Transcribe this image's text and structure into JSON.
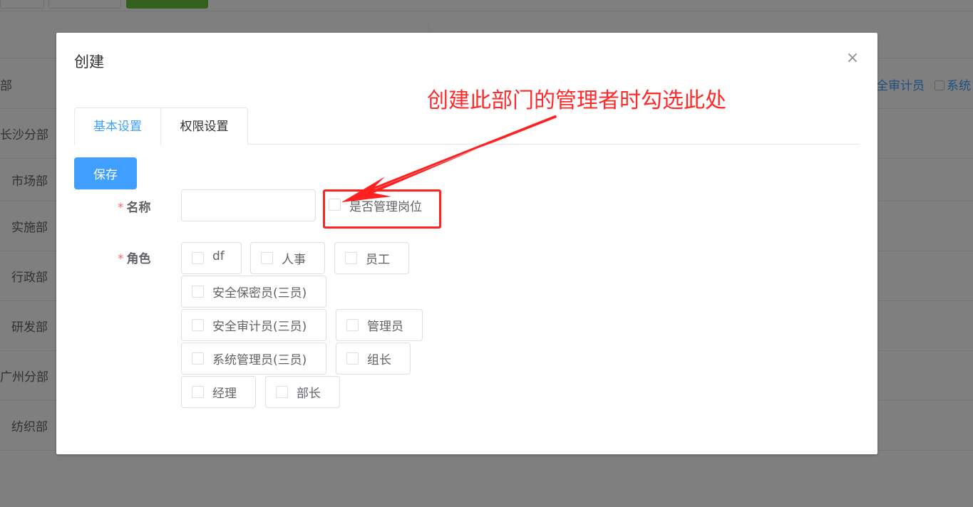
{
  "background": {
    "toolbar_buttons": [
      "",
      "",
      ""
    ],
    "right_labels": [
      "全审计员",
      "系统"
    ],
    "departments": [
      "部",
      "长沙分部",
      "市场部",
      "实施部",
      "行政部",
      "研发部",
      "广州分部",
      "纺织部"
    ]
  },
  "dialog": {
    "title": "创建",
    "close_icon": "×",
    "tabs": [
      {
        "label": "基本设置",
        "active": true
      },
      {
        "label": "权限设置",
        "active": false
      }
    ],
    "save_label": "保存",
    "name_label": "名称",
    "name_value": "",
    "manager_checkbox_label": "是否管理岗位",
    "role_label": "角色",
    "required_mark": "*",
    "roles": [
      "df",
      "人事",
      "员工",
      "安全保密员(三员)",
      "安全审计员(三员)",
      "管理员",
      "系统管理员(三员)",
      "组长",
      "经理",
      "部长"
    ]
  },
  "annotation": {
    "text": "创建此部门的管理者时勾选此处",
    "color": "#ff2a2a"
  },
  "colors": {
    "primary": "#409eff",
    "required": "#f56c6c",
    "overlay": "rgba(0,0,0,0.5)"
  }
}
